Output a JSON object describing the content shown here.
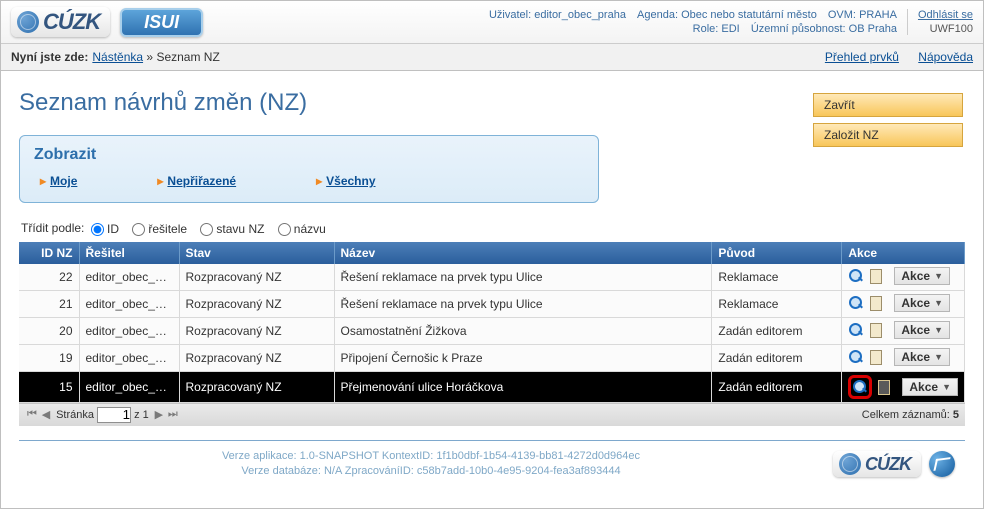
{
  "topbar": {
    "brand1": "CÚZK",
    "brand2": "ISUI",
    "user_label": "Uživatel:",
    "user_value": "editor_obec_praha",
    "agenda_label": "Agenda:",
    "agenda_value": "Obec nebo statutární město",
    "ovm_label": "OVM:",
    "ovm_value": "PRAHA",
    "role_label": "Role:",
    "role_value": "EDI",
    "scope_label": "Územní působnost:",
    "scope_value": "OB Praha",
    "logout": "Odhlásit se",
    "code": "UWF100"
  },
  "breadcrumb": {
    "label": "Nyní jste zde:",
    "item1": "Nástěnka",
    "sep": "»",
    "item2": "Seznam NZ",
    "link_overview": "Přehled prvků",
    "link_help": "Nápověda"
  },
  "page": {
    "title": "Seznam návrhů změn (NZ)",
    "btn_close": "Zavřít",
    "btn_new": "Založit NZ"
  },
  "filter": {
    "title": "Zobrazit",
    "tab_my": "Moje",
    "tab_unassigned": "Nepřiřazené",
    "tab_all": "Všechny"
  },
  "sort": {
    "label": "Třídit podle:",
    "opt_id": "ID",
    "opt_resitele": "řešitele",
    "opt_stavu": "stavu NZ",
    "opt_nazvu": "názvu"
  },
  "columns": {
    "id": "ID NZ",
    "resitel": "Řešitel",
    "stav": "Stav",
    "nazev": "Název",
    "puvod": "Původ",
    "akce": "Akce",
    "akce_btn": "Akce"
  },
  "rows": [
    {
      "id": "22",
      "resitel": "editor_obec_praha",
      "stav": "Rozpracovaný NZ",
      "nazev": "Řešení reklamace na prvek typu Ulice",
      "puvod": "Reklamace"
    },
    {
      "id": "21",
      "resitel": "editor_obec_praha",
      "stav": "Rozpracovaný NZ",
      "nazev": "Řešení reklamace na prvek typu Ulice",
      "puvod": "Reklamace"
    },
    {
      "id": "20",
      "resitel": "editor_obec_praha",
      "stav": "Rozpracovaný NZ",
      "nazev": "Osamostatnění Žižkova",
      "puvod": "Zadán editorem"
    },
    {
      "id": "19",
      "resitel": "editor_obec_praha",
      "stav": "Rozpracovaný NZ",
      "nazev": "Připojení Černošic k Praze",
      "puvod": "Zadán editorem"
    },
    {
      "id": "15",
      "resitel": "editor_obec_praha",
      "stav": "Rozpracovaný NZ",
      "nazev": "Přejmenování ulice Horáčkova",
      "puvod": "Zadán editorem"
    }
  ],
  "pager": {
    "label": "Stránka",
    "page": "1",
    "of": "z 1",
    "total_label": "Celkem záznamů:",
    "total_value": "5"
  },
  "footer": {
    "line1": "Verze aplikace: 1.0-SNAPSHOT KontextID: 1f1b0dbf-1b54-4139-bb81-4272d0d964ec",
    "line2": "Verze databáze: N/A ZpracováníID: c58b7add-10b0-4e95-9204-fea3af893444"
  }
}
